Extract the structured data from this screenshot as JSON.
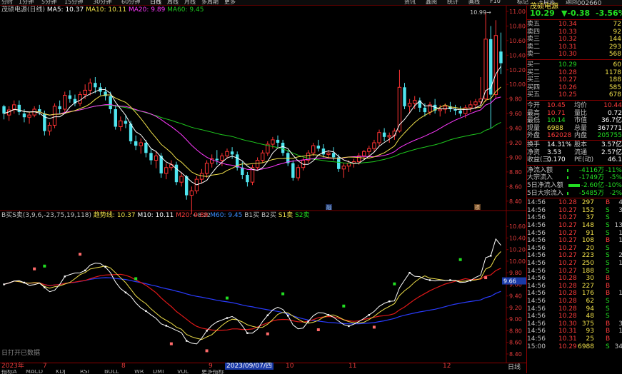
{
  "colors": {
    "up": "#ff3333",
    "down": "#4fe5ef",
    "ma5": "#ffffff",
    "ma10": "#f0e04a",
    "ma20": "#ff39ff",
    "ma60": "#1ec81e",
    "grid": "#7a0000",
    "bg": "#000000",
    "text": "#c0c0c0",
    "yellow": "#f0e04a",
    "red": "#ff3c3c",
    "green": "#22dd22",
    "blue_band": "#2030d0"
  },
  "topbar": {
    "left": [
      "分时",
      "1分钟",
      "5分钟",
      "15分钟",
      "30分钟",
      "60分钟",
      "日线",
      "周线",
      "月线",
      "多周期",
      "更多"
    ],
    "active_index": 6,
    "right": [
      "资讯",
      "鑫阅",
      "统计",
      "画线",
      "F10",
      "标记",
      "+自选",
      "返回"
    ]
  },
  "header": {
    "stock_name": "茂硕电源",
    "code": "002660",
    "price": "10.29",
    "change": "▼-0.38",
    "pct": "-3.56%"
  },
  "main_legend": {
    "title": "茂硕电源(日线)",
    "items": [
      {
        "label": "MA5: 10.37",
        "color": "#ffffff"
      },
      {
        "label": "MA10: 10.11",
        "color": "#f0e04a"
      },
      {
        "label": "MA20: 9.89",
        "color": "#ff39ff"
      },
      {
        "label": "MA60: 9.45",
        "color": "#1ec81e"
      }
    ]
  },
  "main_axis": {
    "labels": [
      "11.00",
      "10.80",
      "10.60",
      "10.40",
      "10.20",
      "10.00",
      "9.80",
      "9.60",
      "9.40",
      "9.20",
      "9.00",
      "8.80",
      "8.60",
      "8.40"
    ],
    "high_label": "10.99",
    "low_label": "8.22",
    "marker_r": "融",
    "marker_m": "模"
  },
  "sub_legend": {
    "title": "B买S卖(3,9,6,-23,75,19,118)",
    "items": [
      {
        "label": "趋势线: 10.37",
        "color": "#f0e04a"
      },
      {
        "label": "M10: 10.11",
        "color": "#ffffff"
      },
      {
        "label": "M20: 9.89",
        "color": "#ff3c3c"
      },
      {
        "label": "M60: 9.45",
        "color": "#3a8cff"
      },
      {
        "label": "B1买",
        "color": "#c0c0c0"
      },
      {
        "label": "B2买",
        "color": "#c0c0c0"
      },
      {
        "label": "S1卖",
        "color": "#f0e04a"
      },
      {
        "label": "S2卖",
        "color": "#22dd22"
      }
    ]
  },
  "sub_axis": {
    "labels": [
      "10.60",
      "10.40",
      "10.20",
      "10.00",
      "9.80",
      "9.60",
      "9.40",
      "9.20",
      "9.00",
      "8.80",
      "8.60",
      "8.40"
    ],
    "current": "9.66"
  },
  "bottom": {
    "months": [
      "2023年",
      "7",
      "8",
      "9",
      "10",
      "11",
      "12"
    ],
    "cursor_date": "2023/09/07/四",
    "footer_left": "日打开已数据",
    "tabs": [
      "指标A",
      "MACD",
      "KDJ",
      "RSI",
      "BOLL",
      "WR",
      "DMI",
      "VOL",
      "更多指标"
    ],
    "right_tabs": [
      "操作",
      "日线"
    ]
  },
  "order_book": {
    "sell": [
      {
        "label": "卖五",
        "price": "10.34",
        "vol": "72"
      },
      {
        "label": "卖四",
        "price": "10.33",
        "vol": "92"
      },
      {
        "label": "卖三",
        "price": "10.32",
        "vol": "144"
      },
      {
        "label": "卖二",
        "price": "10.31",
        "vol": "293"
      },
      {
        "label": "卖一",
        "price": "10.30",
        "vol": "568"
      }
    ],
    "buy": [
      {
        "label": "买一",
        "price": "10.29",
        "vol": "60"
      },
      {
        "label": "买二",
        "price": "10.28",
        "vol": "1178"
      },
      {
        "label": "买三",
        "price": "10.27",
        "vol": "188"
      },
      {
        "label": "买四",
        "price": "10.26",
        "vol": "585"
      },
      {
        "label": "买五",
        "price": "10.25",
        "vol": "678"
      }
    ]
  },
  "quote": [
    {
      "l1": "今开",
      "v1": "10.45",
      "l2": "均价",
      "v2": "10.44",
      "c1": "#ff3c3c",
      "c2": "#ff3c3c"
    },
    {
      "l1": "最高",
      "v1": "10.71",
      "l2": "量比",
      "v2": "0.72",
      "c1": "#ff3c3c",
      "c2": "#ffffff"
    },
    {
      "l1": "最低",
      "v1": "10.14",
      "l2": "市值",
      "v2": "36.7亿",
      "c1": "#22dd22",
      "c2": "#ffffff"
    },
    {
      "l1": "现量",
      "v1": "6988",
      "l2": "总量",
      "v2": "367771",
      "c1": "#f0e04a",
      "c2": "#ffffff"
    },
    {
      "l1": "外盘",
      "v1": "162028",
      "l2": "内盘",
      "v2": "205755",
      "c1": "#ff3c3c",
      "c2": "#22dd22"
    },
    {
      "l1": "换手",
      "v1": "14.31%",
      "l2": "股本",
      "v2": "3.57亿",
      "c1": "#ffffff",
      "c2": "#ffffff"
    },
    {
      "l1": "净资",
      "v1": "3.53",
      "l2": "流通",
      "v2": "2.57亿",
      "c1": "#ffffff",
      "c2": "#ffffff"
    },
    {
      "l1": "收益(三)",
      "v1": "0.170",
      "l2": "PE(动)",
      "v2": "46.1",
      "c1": "#ffffff",
      "c2": "#ffffff"
    }
  ],
  "flows": [
    {
      "label": "净流入额",
      "value": "-4116万",
      "pct": "-11%"
    },
    {
      "label": "大宗流入",
      "value": "-1749万",
      "pct": "-5%"
    },
    {
      "label": "5日净流入额",
      "value": "-2.60亿",
      "pct": "-10%"
    },
    {
      "label": "5日大宗流入",
      "value": "-5485万",
      "pct": "-2%"
    }
  ],
  "ticks": [
    {
      "t": "14:56",
      "p": "10.28",
      "v": "297",
      "d": "B",
      "x": "4"
    },
    {
      "t": "14:56",
      "p": "10.27",
      "v": "152",
      "d": "S",
      "x": "3"
    },
    {
      "t": "14:56",
      "p": "10.27",
      "v": "37",
      "d": "S",
      "x": ""
    },
    {
      "t": "14:56",
      "p": "10.27",
      "v": "148",
      "d": "S",
      "x": "13"
    },
    {
      "t": "14:56",
      "p": "10.27",
      "v": "91",
      "d": "S",
      "x": "1"
    },
    {
      "t": "14:56",
      "p": "10.27",
      "v": "108",
      "d": "B",
      "x": "1"
    },
    {
      "t": "14:56",
      "p": "10.27",
      "v": "20",
      "d": "S",
      "x": ""
    },
    {
      "t": "14:56",
      "p": "10.27",
      "v": "223",
      "d": "S",
      "x": "2"
    },
    {
      "t": "14:56",
      "p": "10.27",
      "v": "250",
      "d": "S",
      "x": "1"
    },
    {
      "t": "14:56",
      "p": "10.27",
      "v": "188",
      "d": "S",
      "x": ""
    },
    {
      "t": "14:56",
      "p": "10.28",
      "v": "30",
      "d": "B",
      "x": ""
    },
    {
      "t": "14:56",
      "p": "10.28",
      "v": "227",
      "d": "B",
      "x": ""
    },
    {
      "t": "14:56",
      "p": "10.28",
      "v": "176",
      "d": "B",
      "x": "1"
    },
    {
      "t": "14:56",
      "p": "10.28",
      "v": "62",
      "d": "S",
      "x": ""
    },
    {
      "t": "14:56",
      "p": "10.28",
      "v": "94",
      "d": "S",
      "x": ""
    },
    {
      "t": "14:56",
      "p": "10.28",
      "v": "48",
      "d": "S",
      "x": ""
    },
    {
      "t": "14:56",
      "p": "10.30",
      "v": "375",
      "d": "B",
      "x": "3"
    },
    {
      "t": "14:56",
      "p": "10.31",
      "v": "93",
      "d": "B",
      "x": "1"
    },
    {
      "t": "14:56",
      "p": "10.31",
      "v": "25",
      "d": "B",
      "x": ""
    },
    {
      "t": "15:00",
      "p": "10.29",
      "v": "6988",
      "d": "S",
      "x": "34"
    }
  ],
  "chart_data": {
    "type": "candlestick",
    "ylim": [
      8.3,
      11.0
    ],
    "sub_ylim": [
      8.35,
      10.75
    ],
    "ohlc": [
      [
        9.7,
        9.72,
        9.52,
        9.6
      ],
      [
        9.58,
        9.7,
        9.5,
        9.65
      ],
      [
        9.66,
        9.78,
        9.6,
        9.72
      ],
      [
        9.72,
        9.78,
        9.58,
        9.62
      ],
      [
        9.6,
        9.66,
        9.48,
        9.55
      ],
      [
        9.55,
        9.62,
        9.46,
        9.58
      ],
      [
        9.58,
        9.7,
        9.55,
        9.66
      ],
      [
        9.66,
        9.72,
        9.58,
        9.62
      ],
      [
        9.6,
        9.64,
        9.3,
        9.36
      ],
      [
        9.36,
        9.48,
        9.3,
        9.44
      ],
      [
        9.44,
        9.74,
        9.4,
        9.7
      ],
      [
        9.7,
        9.78,
        9.6,
        9.66
      ],
      [
        9.66,
        9.9,
        9.62,
        9.85
      ],
      [
        9.85,
        9.92,
        9.75,
        9.8
      ],
      [
        9.8,
        9.86,
        9.7,
        9.74
      ],
      [
        9.74,
        9.9,
        9.7,
        9.86
      ],
      [
        9.86,
        10.0,
        9.8,
        9.92
      ],
      [
        9.92,
        10.08,
        9.85,
        10.02
      ],
      [
        10.02,
        10.1,
        9.88,
        9.96
      ],
      [
        9.96,
        10.02,
        9.85,
        9.9
      ],
      [
        9.9,
        9.96,
        9.78,
        9.84
      ],
      [
        9.84,
        9.9,
        9.6,
        9.66
      ],
      [
        9.66,
        9.72,
        9.38,
        9.42
      ],
      [
        9.42,
        9.56,
        9.36,
        9.5
      ],
      [
        9.5,
        9.58,
        9.4,
        9.46
      ],
      [
        9.46,
        9.5,
        9.18,
        9.22
      ],
      [
        9.22,
        9.3,
        9.1,
        9.16
      ],
      [
        9.16,
        9.26,
        9.05,
        9.2
      ],
      [
        9.2,
        9.24,
        9.0,
        9.06
      ],
      [
        9.06,
        9.12,
        8.9,
        8.96
      ],
      [
        8.96,
        9.08,
        8.85,
        9.02
      ],
      [
        9.02,
        9.06,
        8.72,
        8.78
      ],
      [
        8.78,
        8.92,
        8.7,
        8.86
      ],
      [
        8.86,
        8.96,
        8.82,
        8.9
      ],
      [
        8.9,
        8.94,
        8.62,
        8.66
      ],
      [
        8.66,
        8.8,
        8.6,
        8.74
      ],
      [
        8.74,
        8.76,
        8.42,
        8.48
      ],
      [
        8.48,
        8.6,
        8.22,
        8.54
      ],
      [
        8.54,
        8.74,
        8.5,
        8.7
      ],
      [
        8.7,
        8.84,
        8.64,
        8.78
      ],
      [
        8.78,
        8.96,
        8.72,
        8.92
      ],
      [
        8.92,
        9.04,
        8.86,
        8.98
      ],
      [
        8.98,
        9.1,
        8.9,
        8.96
      ],
      [
        8.96,
        9.06,
        8.88,
        9.02
      ],
      [
        9.02,
        9.12,
        8.98,
        9.08
      ],
      [
        9.08,
        9.14,
        8.98,
        9.04
      ],
      [
        9.04,
        9.08,
        8.82,
        8.86
      ],
      [
        8.86,
        8.94,
        8.7,
        8.76
      ],
      [
        8.76,
        8.8,
        8.6,
        8.66
      ],
      [
        8.66,
        8.9,
        8.62,
        8.86
      ],
      [
        8.86,
        9.0,
        8.82,
        8.96
      ],
      [
        8.96,
        9.1,
        8.92,
        9.06
      ],
      [
        9.06,
        9.22,
        9.02,
        9.18
      ],
      [
        9.18,
        9.28,
        9.12,
        9.24
      ],
      [
        9.24,
        9.3,
        9.14,
        9.2
      ],
      [
        9.2,
        9.24,
        9.02,
        9.06
      ],
      [
        9.06,
        9.1,
        8.88,
        8.92
      ],
      [
        8.92,
        8.96,
        8.68,
        8.72
      ],
      [
        8.72,
        8.9,
        8.68,
        8.86
      ],
      [
        8.86,
        9.0,
        8.82,
        8.96
      ],
      [
        8.96,
        9.1,
        8.92,
        9.06
      ],
      [
        9.06,
        9.2,
        9.02,
        9.16
      ],
      [
        9.16,
        9.24,
        9.08,
        9.12
      ],
      [
        9.12,
        9.18,
        9.0,
        9.04
      ],
      [
        9.04,
        9.1,
        8.98,
        9.06
      ],
      [
        9.06,
        9.14,
        8.96,
        9.0
      ],
      [
        9.0,
        9.04,
        8.8,
        8.84
      ],
      [
        8.84,
        8.92,
        8.72,
        8.88
      ],
      [
        8.88,
        8.96,
        8.8,
        8.92
      ],
      [
        8.92,
        8.98,
        8.86,
        8.94
      ],
      [
        8.94,
        9.06,
        8.9,
        9.02
      ],
      [
        9.02,
        9.1,
        8.96,
        9.08
      ],
      [
        9.08,
        9.16,
        9.0,
        9.12
      ],
      [
        9.12,
        9.24,
        9.08,
        9.2
      ],
      [
        9.2,
        9.38,
        9.16,
        9.34
      ],
      [
        9.34,
        9.4,
        9.22,
        9.28
      ],
      [
        9.28,
        9.34,
        9.2,
        9.3
      ],
      [
        9.3,
        9.4,
        9.24,
        9.36
      ],
      [
        9.36,
        10.2,
        9.34,
        9.96
      ],
      [
        9.96,
        10.02,
        9.66,
        9.7
      ],
      [
        9.7,
        9.8,
        9.6,
        9.74
      ],
      [
        9.74,
        9.84,
        9.66,
        9.78
      ],
      [
        9.78,
        9.82,
        9.62,
        9.68
      ],
      [
        9.68,
        9.74,
        9.56,
        9.62
      ],
      [
        9.62,
        9.76,
        9.58,
        9.72
      ],
      [
        9.72,
        9.8,
        9.6,
        9.64
      ],
      [
        9.64,
        9.72,
        9.56,
        9.66
      ],
      [
        9.66,
        9.74,
        9.6,
        9.7
      ],
      [
        9.7,
        9.76,
        9.62,
        9.66
      ],
      [
        9.66,
        9.72,
        9.58,
        9.64
      ],
      [
        9.64,
        9.7,
        9.56,
        9.6
      ],
      [
        9.6,
        9.72,
        9.54,
        9.68
      ],
      [
        9.68,
        9.78,
        9.62,
        9.72
      ],
      [
        9.72,
        9.8,
        9.66,
        9.76
      ],
      [
        9.76,
        10.1,
        9.72,
        9.8
      ],
      [
        9.8,
        10.99,
        9.76,
        10.62
      ],
      [
        10.62,
        10.8,
        9.4,
        9.86
      ],
      [
        9.86,
        10.88,
        9.8,
        10.67
      ],
      [
        10.45,
        10.71,
        10.14,
        10.29
      ]
    ],
    "ma5_last": 10.37,
    "ma10_last": 10.11,
    "ma20_last": 9.89,
    "ma60_last": 9.45
  }
}
